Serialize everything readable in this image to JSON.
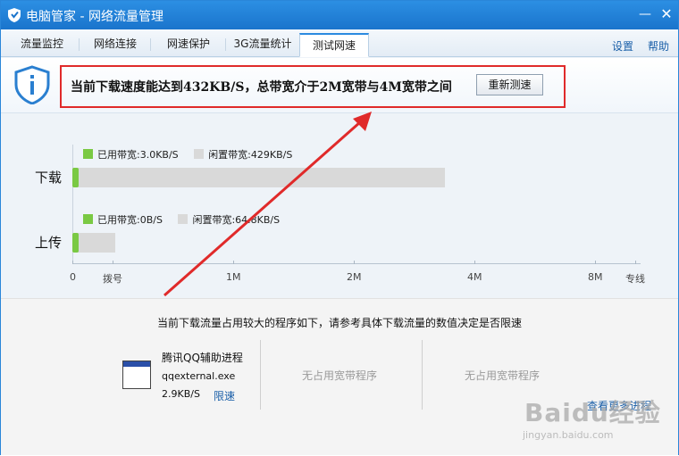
{
  "window": {
    "title": "电脑管家 - 网络流量管理",
    "min_glyph": "—",
    "close_glyph": "✕"
  },
  "tabs": [
    {
      "label": "流量监控"
    },
    {
      "label": "网络连接"
    },
    {
      "label": "网速保护"
    },
    {
      "label": "3G流量统计"
    },
    {
      "label": "测试网速",
      "active": true
    }
  ],
  "top_links": {
    "settings": "设置",
    "help": "帮助"
  },
  "header": {
    "message": "当前下载速度能达到432KB/S，总带宽介于2M宽带与4M宽带之间",
    "retest_button": "重新测速"
  },
  "chart": {
    "download": {
      "label": "下载",
      "used_legend": "已用带宽:3.0KB/S",
      "idle_legend": "闲置带宽:429KB/S"
    },
    "upload": {
      "label": "上传",
      "used_legend": "已用带宽:0B/S",
      "idle_legend": "闲置带宽:64.8KB/S"
    },
    "axis_labels": [
      "0",
      "拨号",
      "1M",
      "2M",
      "4M",
      "8M",
      "专线"
    ]
  },
  "chart_data": {
    "type": "bar",
    "categories": [
      "下载",
      "上传"
    ],
    "series": [
      {
        "name": "已用带宽",
        "values": [
          "3.0KB/S",
          "0B/S"
        ]
      },
      {
        "name": "闲置带宽",
        "values": [
          "429KB/S",
          "64.8KB/S"
        ]
      }
    ],
    "xticks": [
      "0",
      "拨号",
      "1M",
      "2M",
      "4M",
      "8M",
      "专线"
    ]
  },
  "bottom": {
    "caption": "当前下载流量占用较大的程序如下，请参考具体下载流量的数值决定是否限速",
    "program": {
      "name": "腾讯QQ辅助进程",
      "exe": "qqexternal.exe",
      "speed": "2.9KB/S",
      "limit_link": "限速"
    },
    "empty_slot_1": "无占用宽带程序",
    "empty_slot_2": "无占用宽带程序",
    "more_link": "查看更多进程"
  },
  "watermark": {
    "main": "Baidu经验",
    "sub": "jingyan.baidu.com"
  },
  "colors": {
    "titlebar": "#1f7fd6",
    "used_bar": "#7ac943",
    "idle_bar": "#d9d9d9",
    "highlight": "#e02a2a",
    "link": "#1a5fa8"
  }
}
